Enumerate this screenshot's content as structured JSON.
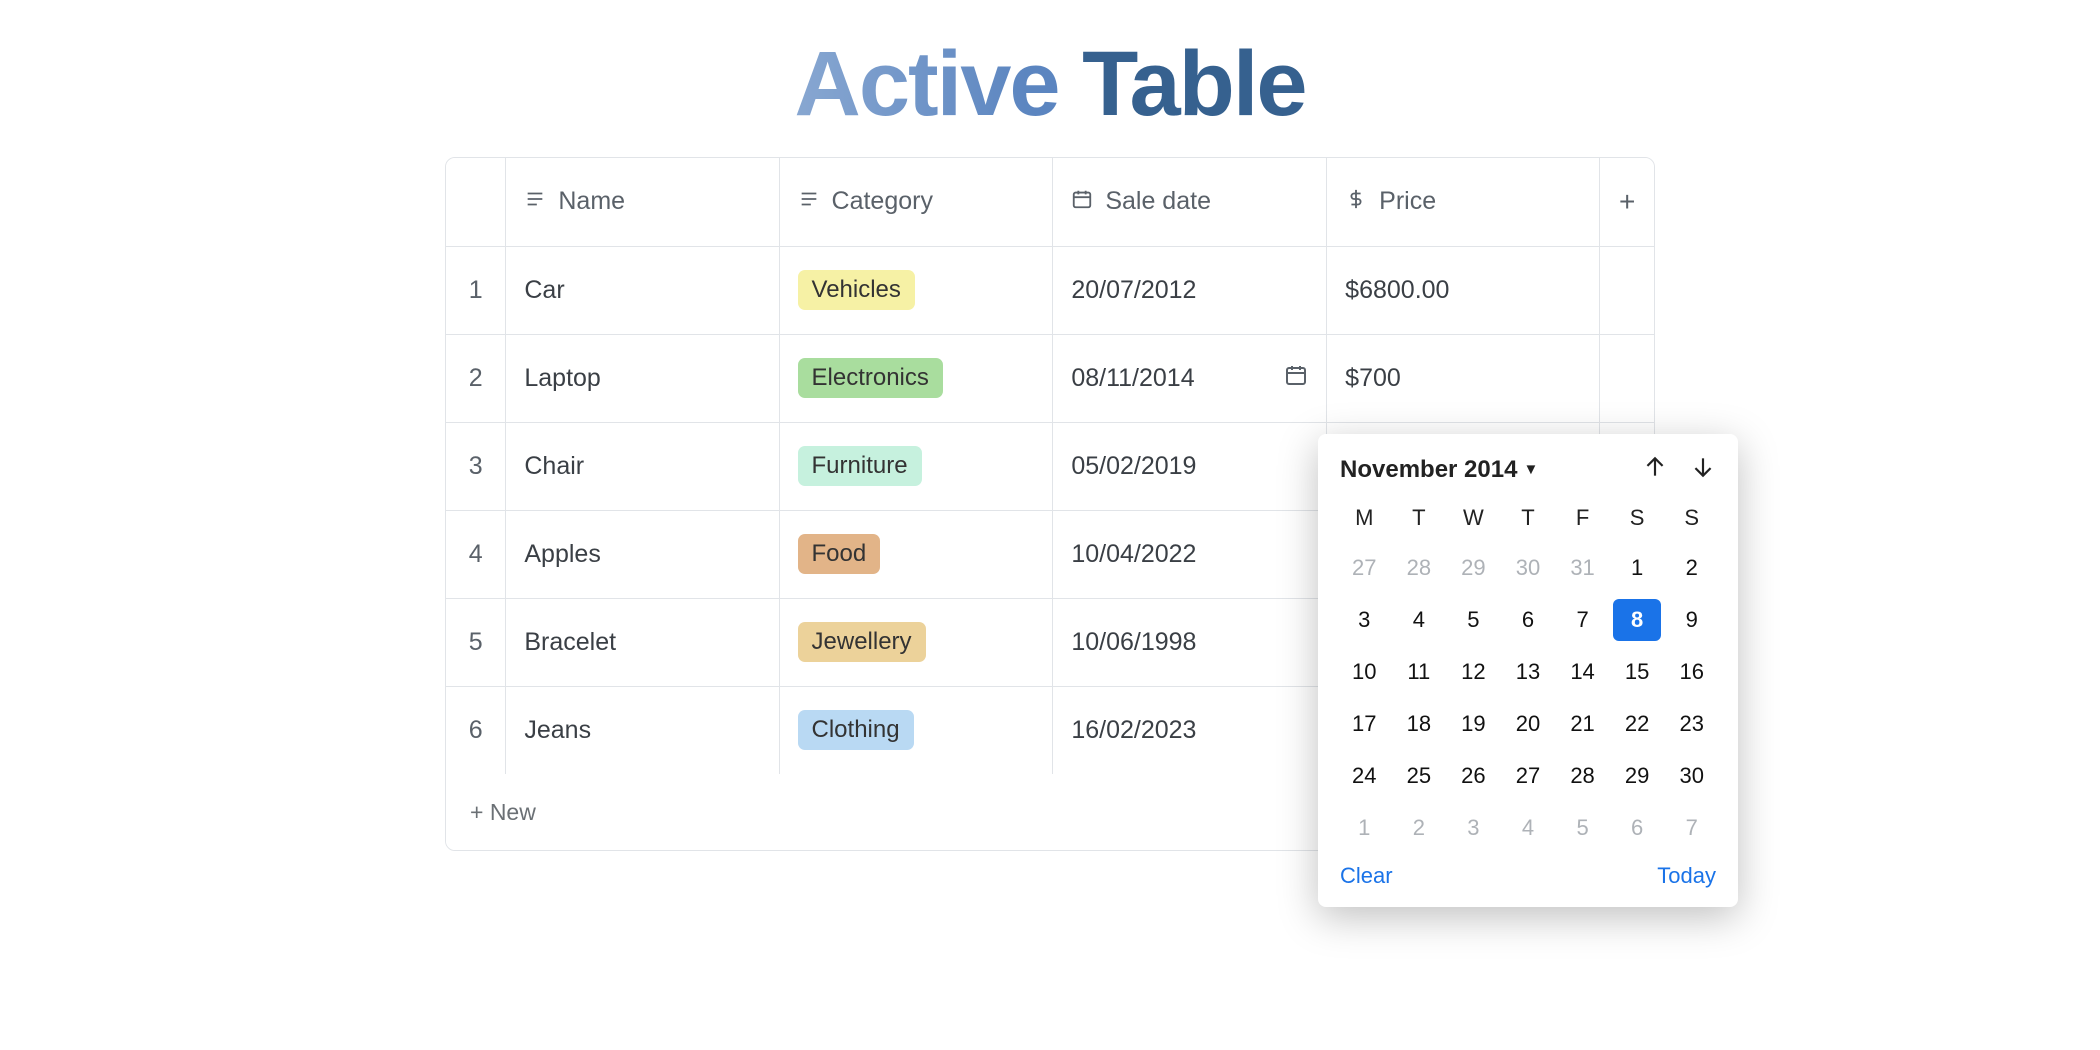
{
  "title": {
    "word1": "Active",
    "word2": "Table"
  },
  "columns": {
    "name": "Name",
    "category": "Category",
    "saleDate": "Sale date",
    "price": "Price",
    "add": "+"
  },
  "rows": [
    {
      "idx": "1",
      "name": "Car",
      "category": "Vehicles",
      "catColor": "#f6f1a5",
      "date": "20/07/2012",
      "price": "$6800.00",
      "dateIcon": false
    },
    {
      "idx": "2",
      "name": "Laptop",
      "category": "Electronics",
      "catColor": "#a9dd9e",
      "date": "08/11/2014",
      "price": "$700",
      "dateIcon": true
    },
    {
      "idx": "3",
      "name": "Chair",
      "category": "Furniture",
      "catColor": "#c6f1de",
      "date": "05/02/2019",
      "price": "",
      "dateIcon": false
    },
    {
      "idx": "4",
      "name": "Apples",
      "category": "Food",
      "catColor": "#e2b488",
      "date": "10/04/2022",
      "price": "",
      "dateIcon": false
    },
    {
      "idx": "5",
      "name": "Bracelet",
      "category": "Jewellery",
      "catColor": "#ecd29a",
      "date": "10/06/1998",
      "price": "",
      "dateIcon": false
    },
    {
      "idx": "6",
      "name": "Jeans",
      "category": "Clothing",
      "catColor": "#b9d9f3",
      "date": "16/02/2023",
      "price": "",
      "dateIcon": false
    }
  ],
  "newRow": "+ New",
  "calendar": {
    "title": "November 2014",
    "dow": [
      "M",
      "T",
      "W",
      "T",
      "F",
      "S",
      "S"
    ],
    "days": [
      {
        "n": "27",
        "muted": true
      },
      {
        "n": "28",
        "muted": true
      },
      {
        "n": "29",
        "muted": true
      },
      {
        "n": "30",
        "muted": true
      },
      {
        "n": "31",
        "muted": true
      },
      {
        "n": "1"
      },
      {
        "n": "2"
      },
      {
        "n": "3"
      },
      {
        "n": "4"
      },
      {
        "n": "5"
      },
      {
        "n": "6"
      },
      {
        "n": "7"
      },
      {
        "n": "8",
        "selected": true
      },
      {
        "n": "9"
      },
      {
        "n": "10"
      },
      {
        "n": "11"
      },
      {
        "n": "12"
      },
      {
        "n": "13"
      },
      {
        "n": "14"
      },
      {
        "n": "15"
      },
      {
        "n": "16"
      },
      {
        "n": "17"
      },
      {
        "n": "18"
      },
      {
        "n": "19"
      },
      {
        "n": "20"
      },
      {
        "n": "21"
      },
      {
        "n": "22"
      },
      {
        "n": "23"
      },
      {
        "n": "24"
      },
      {
        "n": "25"
      },
      {
        "n": "26"
      },
      {
        "n": "27"
      },
      {
        "n": "28"
      },
      {
        "n": "29"
      },
      {
        "n": "30"
      },
      {
        "n": "1",
        "muted": true
      },
      {
        "n": "2",
        "muted": true
      },
      {
        "n": "3",
        "muted": true
      },
      {
        "n": "4",
        "muted": true
      },
      {
        "n": "5",
        "muted": true
      },
      {
        "n": "6",
        "muted": true
      },
      {
        "n": "7",
        "muted": true
      }
    ],
    "clear": "Clear",
    "today": "Today"
  }
}
